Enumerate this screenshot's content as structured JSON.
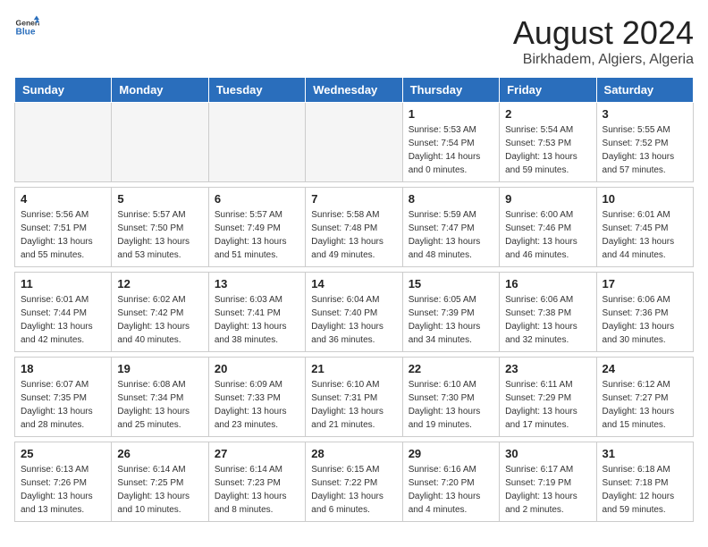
{
  "header": {
    "logo_line1": "General",
    "logo_line2": "Blue",
    "title": "August 2024",
    "subtitle": "Birkhadem, Algiers, Algeria"
  },
  "weekdays": [
    "Sunday",
    "Monday",
    "Tuesday",
    "Wednesday",
    "Thursday",
    "Friday",
    "Saturday"
  ],
  "weeks": [
    [
      {
        "day": "",
        "info": ""
      },
      {
        "day": "",
        "info": ""
      },
      {
        "day": "",
        "info": ""
      },
      {
        "day": "",
        "info": ""
      },
      {
        "day": "1",
        "info": "Sunrise: 5:53 AM\nSunset: 7:54 PM\nDaylight: 14 hours\nand 0 minutes."
      },
      {
        "day": "2",
        "info": "Sunrise: 5:54 AM\nSunset: 7:53 PM\nDaylight: 13 hours\nand 59 minutes."
      },
      {
        "day": "3",
        "info": "Sunrise: 5:55 AM\nSunset: 7:52 PM\nDaylight: 13 hours\nand 57 minutes."
      }
    ],
    [
      {
        "day": "4",
        "info": "Sunrise: 5:56 AM\nSunset: 7:51 PM\nDaylight: 13 hours\nand 55 minutes."
      },
      {
        "day": "5",
        "info": "Sunrise: 5:57 AM\nSunset: 7:50 PM\nDaylight: 13 hours\nand 53 minutes."
      },
      {
        "day": "6",
        "info": "Sunrise: 5:57 AM\nSunset: 7:49 PM\nDaylight: 13 hours\nand 51 minutes."
      },
      {
        "day": "7",
        "info": "Sunrise: 5:58 AM\nSunset: 7:48 PM\nDaylight: 13 hours\nand 49 minutes."
      },
      {
        "day": "8",
        "info": "Sunrise: 5:59 AM\nSunset: 7:47 PM\nDaylight: 13 hours\nand 48 minutes."
      },
      {
        "day": "9",
        "info": "Sunrise: 6:00 AM\nSunset: 7:46 PM\nDaylight: 13 hours\nand 46 minutes."
      },
      {
        "day": "10",
        "info": "Sunrise: 6:01 AM\nSunset: 7:45 PM\nDaylight: 13 hours\nand 44 minutes."
      }
    ],
    [
      {
        "day": "11",
        "info": "Sunrise: 6:01 AM\nSunset: 7:44 PM\nDaylight: 13 hours\nand 42 minutes."
      },
      {
        "day": "12",
        "info": "Sunrise: 6:02 AM\nSunset: 7:42 PM\nDaylight: 13 hours\nand 40 minutes."
      },
      {
        "day": "13",
        "info": "Sunrise: 6:03 AM\nSunset: 7:41 PM\nDaylight: 13 hours\nand 38 minutes."
      },
      {
        "day": "14",
        "info": "Sunrise: 6:04 AM\nSunset: 7:40 PM\nDaylight: 13 hours\nand 36 minutes."
      },
      {
        "day": "15",
        "info": "Sunrise: 6:05 AM\nSunset: 7:39 PM\nDaylight: 13 hours\nand 34 minutes."
      },
      {
        "day": "16",
        "info": "Sunrise: 6:06 AM\nSunset: 7:38 PM\nDaylight: 13 hours\nand 32 minutes."
      },
      {
        "day": "17",
        "info": "Sunrise: 6:06 AM\nSunset: 7:36 PM\nDaylight: 13 hours\nand 30 minutes."
      }
    ],
    [
      {
        "day": "18",
        "info": "Sunrise: 6:07 AM\nSunset: 7:35 PM\nDaylight: 13 hours\nand 28 minutes."
      },
      {
        "day": "19",
        "info": "Sunrise: 6:08 AM\nSunset: 7:34 PM\nDaylight: 13 hours\nand 25 minutes."
      },
      {
        "day": "20",
        "info": "Sunrise: 6:09 AM\nSunset: 7:33 PM\nDaylight: 13 hours\nand 23 minutes."
      },
      {
        "day": "21",
        "info": "Sunrise: 6:10 AM\nSunset: 7:31 PM\nDaylight: 13 hours\nand 21 minutes."
      },
      {
        "day": "22",
        "info": "Sunrise: 6:10 AM\nSunset: 7:30 PM\nDaylight: 13 hours\nand 19 minutes."
      },
      {
        "day": "23",
        "info": "Sunrise: 6:11 AM\nSunset: 7:29 PM\nDaylight: 13 hours\nand 17 minutes."
      },
      {
        "day": "24",
        "info": "Sunrise: 6:12 AM\nSunset: 7:27 PM\nDaylight: 13 hours\nand 15 minutes."
      }
    ],
    [
      {
        "day": "25",
        "info": "Sunrise: 6:13 AM\nSunset: 7:26 PM\nDaylight: 13 hours\nand 13 minutes."
      },
      {
        "day": "26",
        "info": "Sunrise: 6:14 AM\nSunset: 7:25 PM\nDaylight: 13 hours\nand 10 minutes."
      },
      {
        "day": "27",
        "info": "Sunrise: 6:14 AM\nSunset: 7:23 PM\nDaylight: 13 hours\nand 8 minutes."
      },
      {
        "day": "28",
        "info": "Sunrise: 6:15 AM\nSunset: 7:22 PM\nDaylight: 13 hours\nand 6 minutes."
      },
      {
        "day": "29",
        "info": "Sunrise: 6:16 AM\nSunset: 7:20 PM\nDaylight: 13 hours\nand 4 minutes."
      },
      {
        "day": "30",
        "info": "Sunrise: 6:17 AM\nSunset: 7:19 PM\nDaylight: 13 hours\nand 2 minutes."
      },
      {
        "day": "31",
        "info": "Sunrise: 6:18 AM\nSunset: 7:18 PM\nDaylight: 12 hours\nand 59 minutes."
      }
    ]
  ]
}
